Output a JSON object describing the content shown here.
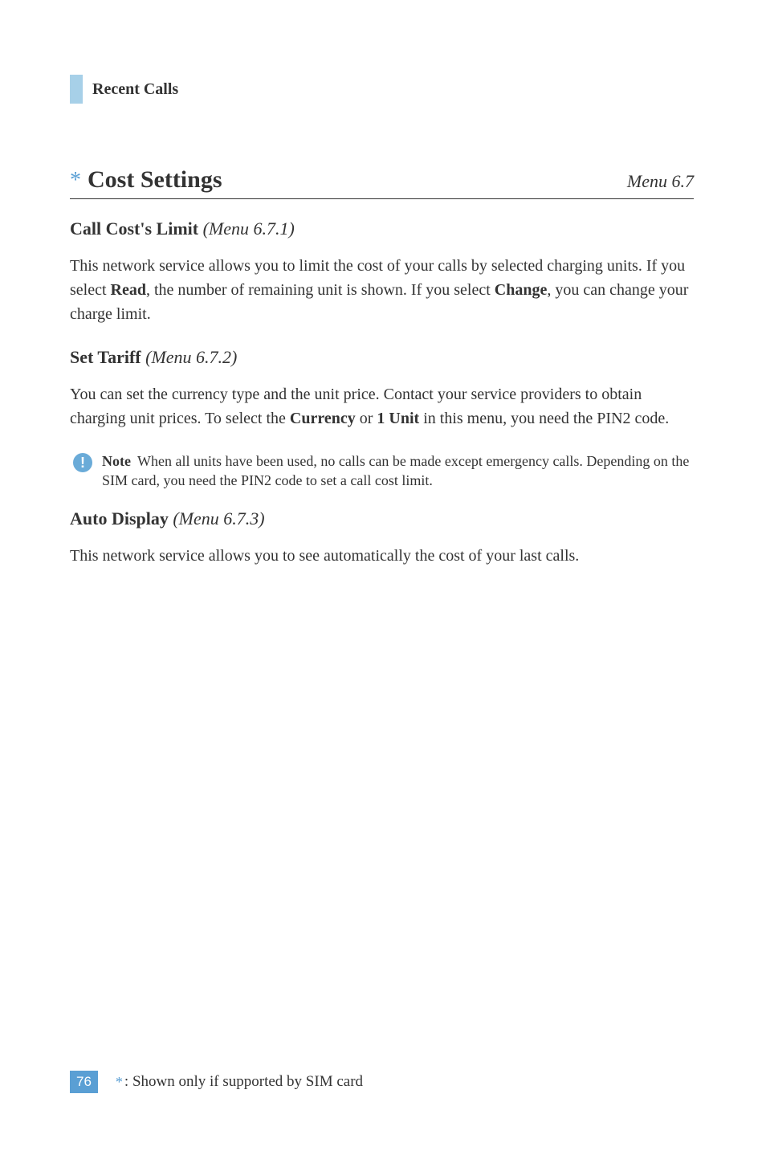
{
  "breadcrumb": {
    "title": "Recent Calls"
  },
  "section": {
    "asterisk": "*",
    "title": "Cost Settings",
    "menu": "Menu 6.7"
  },
  "subsection1": {
    "title": "Call Cost's Limit",
    "menu": "(Menu 6.7.1)",
    "para_before": "This network service allows you to limit the cost of your calls by selected charging units. If you select ",
    "bold1": "Read",
    "para_mid": ", the number of remaining unit is shown. If you select ",
    "bold2": "Change",
    "para_after": ", you can change your charge limit."
  },
  "subsection2": {
    "title": "Set Tariff",
    "menu": "(Menu 6.7.2)",
    "para_before": "You can set the currency type and the unit price. Contact your service providers to obtain charging unit prices. To select the ",
    "bold1": "Currency",
    "para_mid": " or ",
    "bold2": "1 Unit",
    "para_after": " in this menu, you need the PIN2 code."
  },
  "note": {
    "icon_glyph": "!",
    "label": "Note",
    "text": "When all units have been used, no calls can be made except emergency calls. Depending on the SIM card, you need the PIN2 code to set a call cost limit."
  },
  "subsection3": {
    "title": "Auto Display",
    "menu": "(Menu 6.7.3)",
    "para": "This network service allows you to see automatically the cost of your last calls."
  },
  "footer": {
    "page_number": "76",
    "asterisk": "*",
    "text": ": Shown only if supported by SIM card"
  }
}
